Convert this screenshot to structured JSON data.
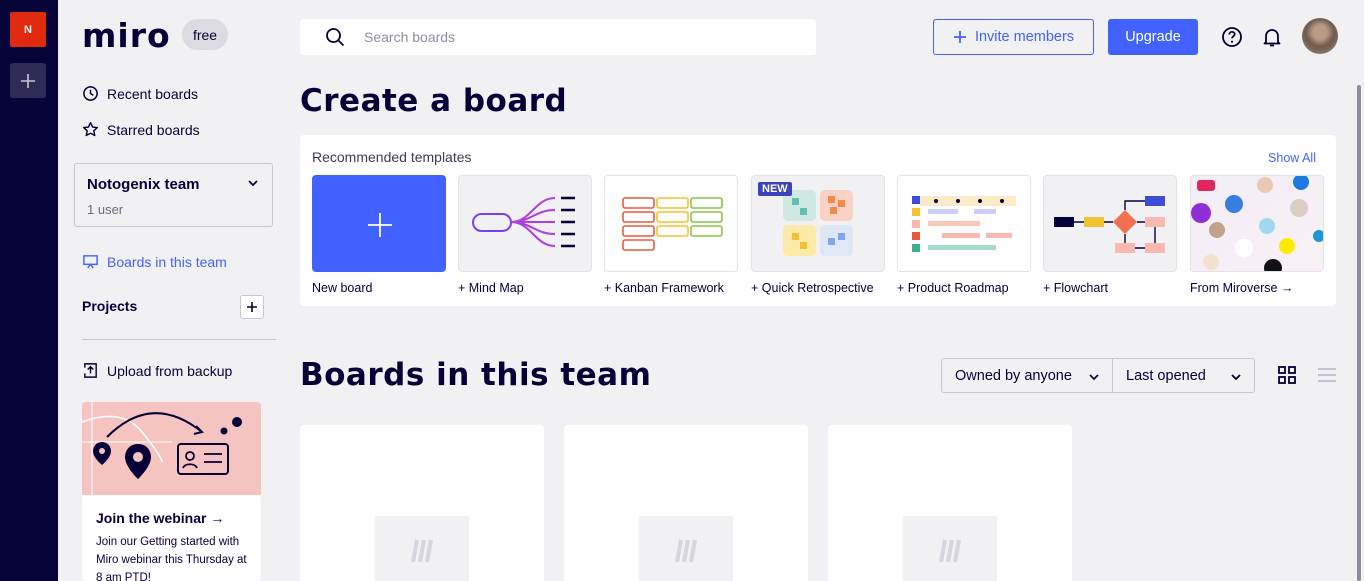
{
  "rail": {
    "team_initial": "N"
  },
  "sidebar": {
    "logo": "miro",
    "plan_badge": "free",
    "nav": {
      "recent": "Recent boards",
      "starred": "Starred boards"
    },
    "team": {
      "name": "Notogenix team",
      "users": "1 user"
    },
    "boards_in_team": "Boards in this team",
    "projects": "Projects",
    "upload": "Upload from backup",
    "webinar": {
      "title": "Join the webinar →",
      "text": "Join our Getting started with Miro webinar this Thursday at 8 am PTD!"
    }
  },
  "topbar": {
    "search_placeholder": "Search boards",
    "invite": "Invite members",
    "upgrade": "Upgrade"
  },
  "main": {
    "create_title": "Create a board",
    "recommended": "Recommended templates",
    "show_all": "Show All",
    "templates": [
      {
        "label": "New board"
      },
      {
        "label": "+ Mind Map"
      },
      {
        "label": "+ Kanban Framework"
      },
      {
        "label": "+ Quick Retrospective",
        "badge": "NEW"
      },
      {
        "label": "+ Product Roadmap"
      },
      {
        "label": "+ Flowchart"
      },
      {
        "label": "From Miroverse →"
      }
    ],
    "boards_title": "Boards in this team",
    "filter_owner": "Owned by anyone",
    "filter_sort": "Last opened"
  },
  "colors": {
    "accent": "#4262ff",
    "rail": "#07043a",
    "team_tile": "#e0290f",
    "webinar_art": "#f5c4c0"
  }
}
